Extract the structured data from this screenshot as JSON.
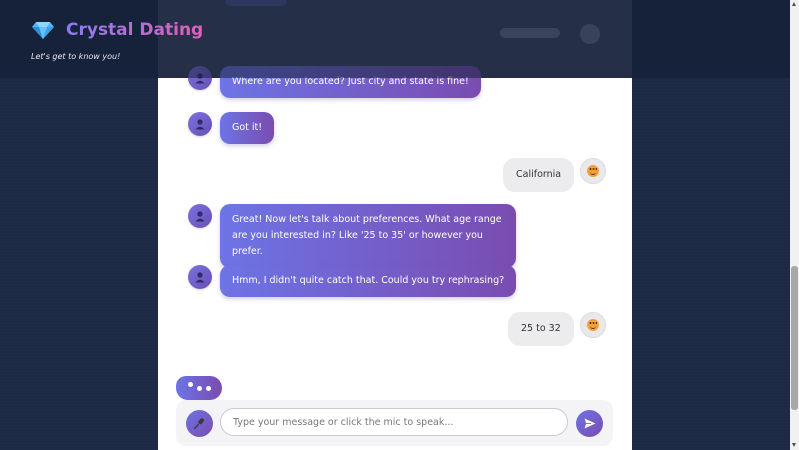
{
  "header": {
    "title": "Crystal Dating",
    "tagline": "Let's get to know you!",
    "logo_icon": "gem-icon",
    "title_gradient": [
      "#8b7bf0",
      "#e05fb6"
    ]
  },
  "messages": [
    {
      "sender": "bot",
      "text": "Where are you located? Just city and state is fine!"
    },
    {
      "sender": "bot",
      "text": "Got it!"
    },
    {
      "sender": "user",
      "text": "California"
    },
    {
      "sender": "bot",
      "text": "Great! Now let's talk about preferences. What age range are you interested in? Like '25 to 35' or however you prefer."
    },
    {
      "sender": "bot",
      "text": "Hmm, I didn't quite catch that. Could you try rephrasing?"
    },
    {
      "sender": "user",
      "text": "25 to 32"
    }
  ],
  "composer": {
    "placeholder": "Type your message or click the mic to speak...",
    "value": "",
    "mic_icon": "microphone-icon",
    "send_icon": "send-icon"
  },
  "colors": {
    "accent_start": "#6d74e6",
    "accent_end": "#7a4cb0",
    "page_bg": "#1c2a45",
    "header_bg": "#16213a",
    "user_bubble": "#ececee"
  }
}
